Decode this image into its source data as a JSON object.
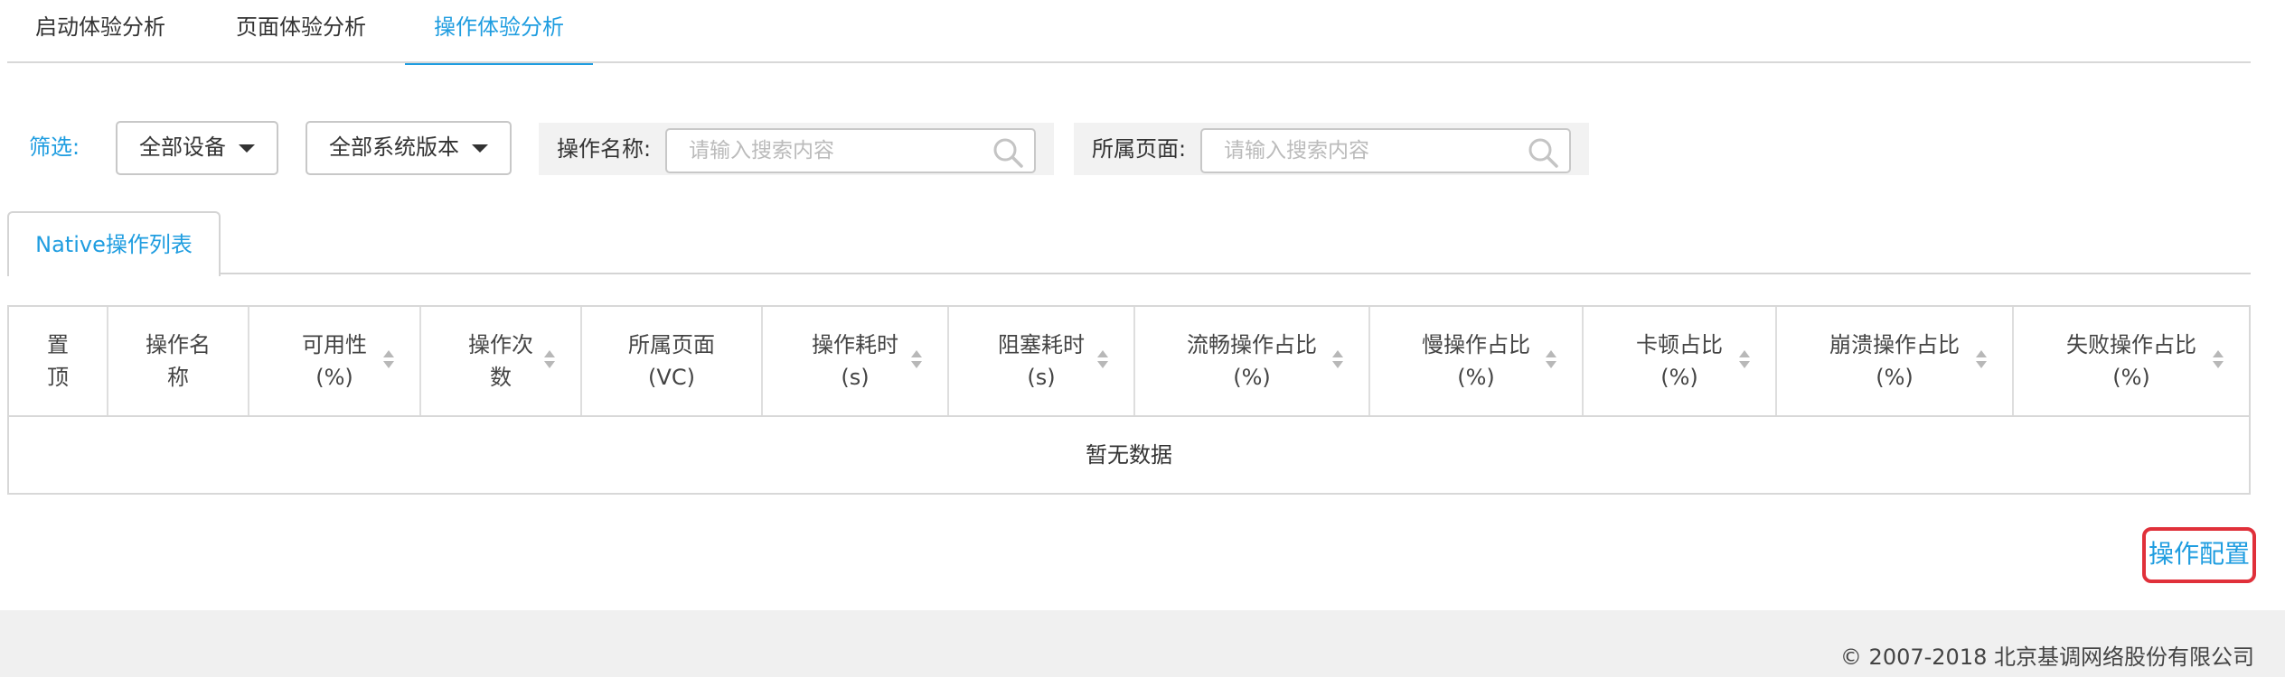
{
  "tabs": [
    {
      "label": "启动体验分析",
      "active": false
    },
    {
      "label": "页面体验分析",
      "active": false
    },
    {
      "label": "操作体验分析",
      "active": true
    }
  ],
  "filters": {
    "label": "筛选:",
    "device_dropdown": "全部设备",
    "os_dropdown": "全部系统版本",
    "operation_name": {
      "label": "操作名称:",
      "placeholder": "请输入搜索内容"
    },
    "page_name": {
      "label": "所属页面:",
      "placeholder": "请输入搜索内容"
    }
  },
  "sub_tab": "Native操作列表",
  "table": {
    "columns": [
      {
        "line1": "置",
        "line2": "顶"
      },
      {
        "line1": "操作名",
        "line2": "称"
      },
      {
        "line1": "可用性",
        "line2": "(%)"
      },
      {
        "line1": "操作次",
        "line2": "数"
      },
      {
        "line1": "所属页面",
        "line2": "(VC)"
      },
      {
        "line1": "操作耗时",
        "line2": "(s)"
      },
      {
        "line1": "阻塞耗时",
        "line2": "(s)"
      },
      {
        "line1": "流畅操作占比",
        "line2": "(%)"
      },
      {
        "line1": "慢操作占比",
        "line2": "(%)"
      },
      {
        "line1": "卡顿占比",
        "line2": "(%)"
      },
      {
        "line1": "崩溃操作占比",
        "line2": "(%)"
      },
      {
        "line1": "失败操作占比",
        "line2": "(%)"
      }
    ],
    "empty_text": "暂无数据"
  },
  "op_config": "操作配置",
  "footer": {
    "copyright": "© 2007-2018  北京基调网络股份有限公司"
  },
  "colors": {
    "accent": "#1f9de0",
    "highlight": "#e0303a"
  }
}
